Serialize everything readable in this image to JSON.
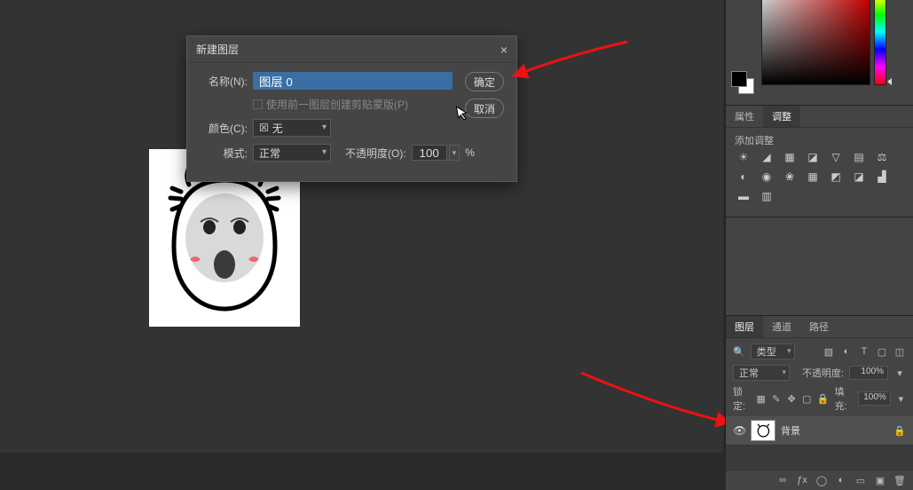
{
  "dialog": {
    "title": "新建图层",
    "name_label": "名称(N):",
    "name_value": "图层 0",
    "mask_checkbox": "使用前一图层创建剪贴蒙版(P)",
    "color_label": "颜色(C):",
    "color_value": "无",
    "mode_label": "模式:",
    "mode_value": "正常",
    "opacity_label": "不透明度(O):",
    "opacity_value": "100",
    "opacity_unit": "%",
    "ok": "确定",
    "cancel": "取消"
  },
  "props": {
    "tab_props": "属性",
    "tab_adjust": "调整",
    "add_adjust": "添加调整"
  },
  "layers": {
    "tab_layers": "图层",
    "tab_channels": "通道",
    "tab_paths": "路径",
    "kind_label": "类型",
    "blend_mode": "正常",
    "opacity_label": "不透明度:",
    "opacity_value": "100%",
    "lock_label": "锁定:",
    "fill_label": "填充:",
    "fill_value": "100%",
    "item_name": "背景"
  },
  "icons": {
    "search": "🔍",
    "eye": "👁",
    "lock": "🔒",
    "close": "×",
    "none_box": "☒",
    "caret": "▾"
  }
}
